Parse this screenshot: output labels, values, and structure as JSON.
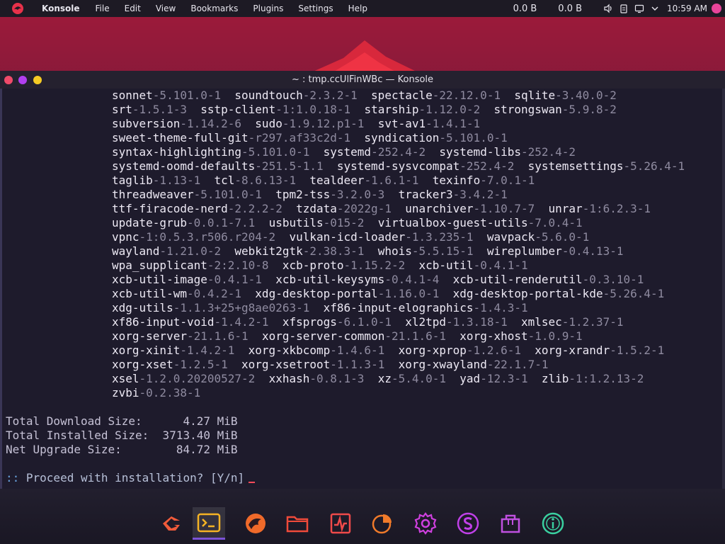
{
  "topbar": {
    "app_name": "Konsole",
    "menu": [
      "File",
      "Edit",
      "View",
      "Bookmarks",
      "Plugins",
      "Settings",
      "Help"
    ],
    "net_down": "0.0 B",
    "net_up": "0.0 B",
    "clock": "10:59 AM"
  },
  "window": {
    "title": "~ : tmp.ccUlFinWBc — Konsole"
  },
  "terminal": {
    "package_lines": [
      [
        [
          "sonnet",
          "-5.101.0-1"
        ],
        [
          "soundtouch",
          "-2.3.2-1"
        ],
        [
          "spectacle",
          "-22.12.0-1"
        ],
        [
          "sqlite",
          "-3.40.0-2"
        ]
      ],
      [
        [
          "srt",
          "-1.5.1-3"
        ],
        [
          "sstp-client",
          "-1:1.0.18-1"
        ],
        [
          "starship",
          "-1.12.0-2"
        ],
        [
          "strongswan",
          "-5.9.8-2"
        ]
      ],
      [
        [
          "subversion",
          "-1.14.2-6"
        ],
        [
          "sudo",
          "-1.9.12.p1-1"
        ],
        [
          "svt-av1",
          "-1.4.1-1"
        ]
      ],
      [
        [
          "sweet-theme-full-git",
          "-r297.af33c2d-1"
        ],
        [
          "syndication",
          "-5.101.0-1"
        ]
      ],
      [
        [
          "syntax-highlighting",
          "-5.101.0-1"
        ],
        [
          "systemd",
          "-252.4-2"
        ],
        [
          "systemd-libs",
          "-252.4-2"
        ]
      ],
      [
        [
          "systemd-oomd-defaults",
          "-251.5-1.1"
        ],
        [
          "systemd-sysvcompat",
          "-252.4-2"
        ],
        [
          "systemsettings",
          "-5.26.4-1"
        ]
      ],
      [
        [
          "taglib",
          "-1.13-1"
        ],
        [
          "tcl",
          "-8.6.13-1"
        ],
        [
          "tealdeer",
          "-1.6.1-1"
        ],
        [
          "texinfo",
          "-7.0.1-1"
        ]
      ],
      [
        [
          "threadweaver",
          "-5.101.0-1"
        ],
        [
          "tpm2-tss",
          "-3.2.0-3"
        ],
        [
          "tracker3",
          "-3.4.2-1"
        ]
      ],
      [
        [
          "ttf-firacode-nerd",
          "-2.2.2-2"
        ],
        [
          "tzdata",
          "-2022g-1"
        ],
        [
          "unarchiver",
          "-1.10.7-7"
        ],
        [
          "unrar",
          "-1:6.2.3-1"
        ]
      ],
      [
        [
          "update-grub",
          "-0.0.1-7.1"
        ],
        [
          "usbutils",
          "-015-2"
        ],
        [
          "virtualbox-guest-utils",
          "-7.0.4-1"
        ]
      ],
      [
        [
          "vpnc",
          "-1:0.5.3.r506.r204-2"
        ],
        [
          "vulkan-icd-loader",
          "-1.3.235-1"
        ],
        [
          "wavpack",
          "-5.6.0-1"
        ]
      ],
      [
        [
          "wayland",
          "-1.21.0-2"
        ],
        [
          "webkit2gtk",
          "-2.38.3-1"
        ],
        [
          "whois",
          "-5.5.15-1"
        ],
        [
          "wireplumber",
          "-0.4.13-1"
        ]
      ],
      [
        [
          "wpa_supplicant",
          "-2:2.10-8"
        ],
        [
          "xcb-proto",
          "-1.15.2-2"
        ],
        [
          "xcb-util",
          "-0.4.1-1"
        ]
      ],
      [
        [
          "xcb-util-image",
          "-0.4.1-1"
        ],
        [
          "xcb-util-keysyms",
          "-0.4.1-4"
        ],
        [
          "xcb-util-renderutil",
          "-0.3.10-1"
        ]
      ],
      [
        [
          "xcb-util-wm",
          "-0.4.2-1"
        ],
        [
          "xdg-desktop-portal",
          "-1.16.0-1"
        ],
        [
          "xdg-desktop-portal-kde",
          "-5.26.4-1"
        ]
      ],
      [
        [
          "xdg-utils",
          "-1.1.3+25+g8ae0263-1"
        ],
        [
          "xf86-input-elographics",
          "-1.4.3-1"
        ]
      ],
      [
        [
          "xf86-input-void",
          "-1.4.2-1"
        ],
        [
          "xfsprogs",
          "-6.1.0-1"
        ],
        [
          "xl2tpd",
          "-1.3.18-1"
        ],
        [
          "xmlsec",
          "-1.2.37-1"
        ]
      ],
      [
        [
          "xorg-server",
          "-21.1.6-1"
        ],
        [
          "xorg-server-common",
          "-21.1.6-1"
        ],
        [
          "xorg-xhost",
          "-1.0.9-1"
        ]
      ],
      [
        [
          "xorg-xinit",
          "-1.4.2-1"
        ],
        [
          "xorg-xkbcomp",
          "-1.4.6-1"
        ],
        [
          "xorg-xprop",
          "-1.2.6-1"
        ],
        [
          "xorg-xrandr",
          "-1.5.2-1"
        ]
      ],
      [
        [
          "xorg-xset",
          "-1.2.5-1"
        ],
        [
          "xorg-xsetroot",
          "-1.1.3-1"
        ],
        [
          "xorg-xwayland",
          "-22.1.7-1"
        ]
      ],
      [
        [
          "xsel",
          "-1.2.0.20200527-2"
        ],
        [
          "xxhash",
          "-0.8.1-3"
        ],
        [
          "xz",
          "-5.4.0-1"
        ],
        [
          "yad",
          "-12.3-1"
        ],
        [
          "zlib",
          "-1:1.2.13-2"
        ]
      ],
      [
        [
          "zvbi",
          "-0.2.38-1"
        ]
      ]
    ],
    "summary": [
      "Total Download Size:      4.27 MiB",
      "Total Installed Size:  3713.40 MiB",
      "Net Upgrade Size:        84.72 MiB"
    ],
    "prompt_prefix": "::",
    "prompt_text": " Proceed with installation? [Y/n]"
  },
  "dock": {
    "items": [
      {
        "name": "garuda-launcher-icon",
        "color": "#f05a3a"
      },
      {
        "name": "terminal-icon",
        "color": "#f5b324",
        "active": true
      },
      {
        "name": "dragon-browser-icon",
        "color": "#f06a2a"
      },
      {
        "name": "file-manager-icon",
        "color": "#f04a3a"
      },
      {
        "name": "system-monitor-icon",
        "color": "#f04a4a"
      },
      {
        "name": "disk-usage-icon",
        "color": "#f07a2a"
      },
      {
        "name": "settings-icon",
        "color": "#d040e0"
      },
      {
        "name": "garuda-assistant-icon",
        "color": "#c040e8"
      },
      {
        "name": "package-manager-icon",
        "color": "#c050e0"
      },
      {
        "name": "info-icon",
        "color": "#3ad0a0"
      }
    ]
  }
}
